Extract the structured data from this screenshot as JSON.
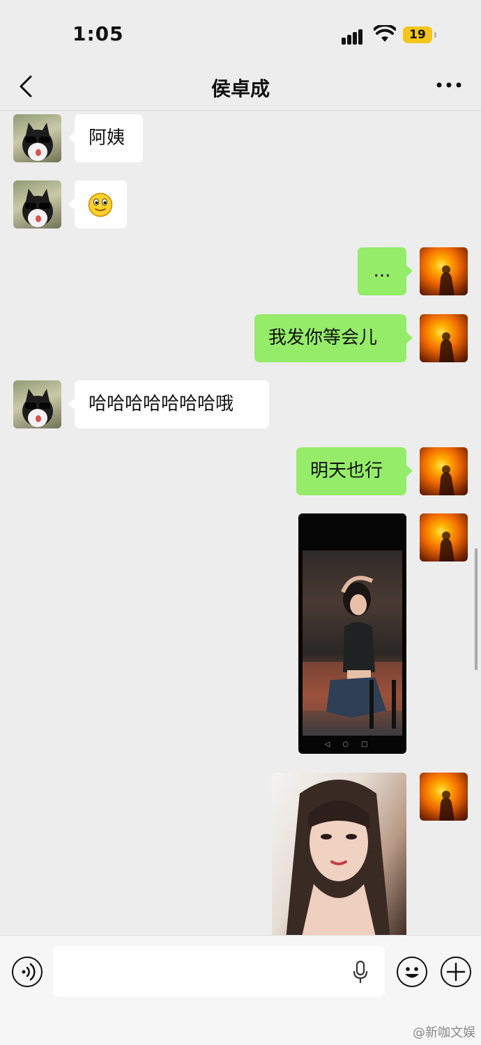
{
  "status_bar": {
    "time": "1:05",
    "battery": "19"
  },
  "header": {
    "title": "侯卓成"
  },
  "messages": [
    {
      "side": "left",
      "type": "text",
      "text": "阿姨"
    },
    {
      "side": "left",
      "type": "emoji",
      "icon": "smiling-face-emoji"
    },
    {
      "side": "right",
      "type": "text",
      "text": "..."
    },
    {
      "side": "right",
      "type": "text",
      "text": "我发你等会儿"
    },
    {
      "side": "left",
      "type": "text",
      "text": "哈哈哈哈哈哈哈哦"
    },
    {
      "side": "right",
      "type": "text",
      "text": "明天也行"
    },
    {
      "side": "right",
      "type": "image",
      "description": "phone screenshot photo"
    },
    {
      "side": "right",
      "type": "image",
      "description": "selfie photo"
    }
  ],
  "input_bar": {
    "placeholder": ""
  },
  "watermark": "@新咖文娱",
  "colors": {
    "accent_bubble": "#95ec69",
    "background": "#ededed",
    "battery": "#f4c51a"
  }
}
